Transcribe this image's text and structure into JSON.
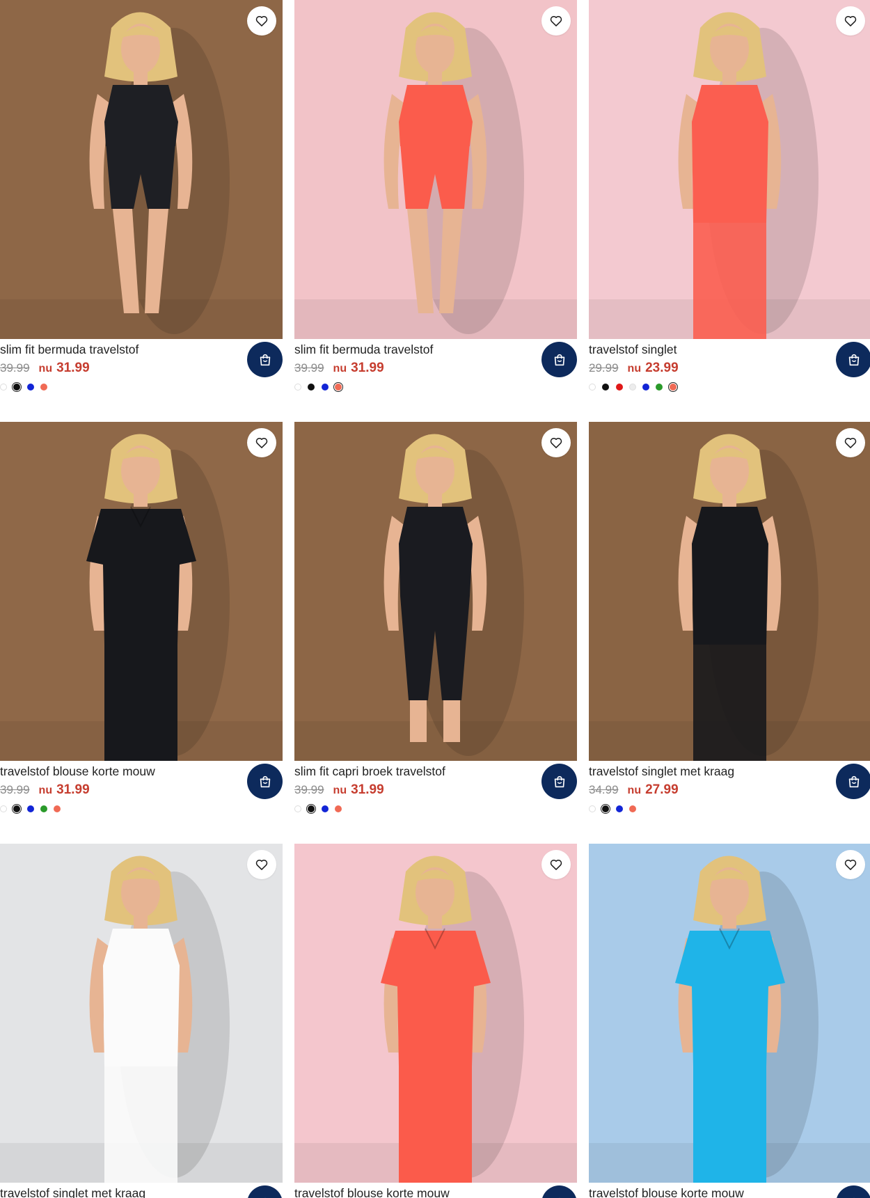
{
  "products": [
    {
      "name": "slim fit bermuda travelstof",
      "old_price": "39.99",
      "nu_label": "nu",
      "new_price": "31.99",
      "photo": {
        "bg": "#8e6747",
        "garment": "#1e1f24",
        "style": "bermuda"
      },
      "swatches": [
        {
          "color": "#ffffff",
          "selected": false
        },
        {
          "color": "#111111",
          "selected": true
        },
        {
          "color": "#1225d6",
          "selected": false
        },
        {
          "color": "#f06a55",
          "selected": false
        }
      ]
    },
    {
      "name": "slim fit bermuda travelstof",
      "old_price": "39.99",
      "nu_label": "nu",
      "new_price": "31.99",
      "photo": {
        "bg": "#f2c3c8",
        "garment": "#fb5c4c",
        "style": "bermuda"
      },
      "swatches": [
        {
          "color": "#ffffff",
          "selected": false
        },
        {
          "color": "#111111",
          "selected": false
        },
        {
          "color": "#1225d6",
          "selected": false
        },
        {
          "color": "#f06a55",
          "selected": true
        }
      ]
    },
    {
      "name": "travelstof singlet",
      "old_price": "29.99",
      "nu_label": "nu",
      "new_price": "23.99",
      "photo": {
        "bg": "#f3c9d0",
        "garment": "#fb5e50",
        "style": "singlet"
      },
      "swatches": [
        {
          "color": "#ffffff",
          "selected": false
        },
        {
          "color": "#111111",
          "selected": false
        },
        {
          "color": "#e01818",
          "selected": false
        },
        {
          "color": "#ececec",
          "selected": false
        },
        {
          "color": "#1225d6",
          "selected": false
        },
        {
          "color": "#2a9a2a",
          "selected": false
        },
        {
          "color": "#f06a55",
          "selected": true
        }
      ]
    },
    {
      "name": "travelstof blouse korte mouw",
      "old_price": "39.99",
      "nu_label": "nu",
      "new_price": "31.99",
      "photo": {
        "bg": "#8f6848",
        "garment": "#17181c",
        "style": "blouse"
      },
      "swatches": [
        {
          "color": "#ffffff",
          "selected": false
        },
        {
          "color": "#111111",
          "selected": true
        },
        {
          "color": "#1225d6",
          "selected": false
        },
        {
          "color": "#2a9a2a",
          "selected": false
        },
        {
          "color": "#f06a55",
          "selected": false
        }
      ]
    },
    {
      "name": "slim fit capri broek travelstof",
      "old_price": "39.99",
      "nu_label": "nu",
      "new_price": "31.99",
      "photo": {
        "bg": "#8d6646",
        "garment": "#1a1b20",
        "style": "capri"
      },
      "swatches": [
        {
          "color": "#ffffff",
          "selected": false
        },
        {
          "color": "#111111",
          "selected": true
        },
        {
          "color": "#1225d6",
          "selected": false
        },
        {
          "color": "#f06a55",
          "selected": false
        }
      ]
    },
    {
      "name": "travelstof singlet met kraag",
      "old_price": "34.99",
      "nu_label": "nu",
      "new_price": "27.99",
      "photo": {
        "bg": "#8a6444",
        "garment": "#17181c",
        "style": "singlet"
      },
      "swatches": [
        {
          "color": "#ffffff",
          "selected": false
        },
        {
          "color": "#111111",
          "selected": true
        },
        {
          "color": "#1225d6",
          "selected": false
        },
        {
          "color": "#f06a55",
          "selected": false
        }
      ]
    },
    {
      "name": "travelstof singlet met kraag",
      "old_price": "",
      "nu_label": "",
      "new_price": "",
      "photo": {
        "bg": "#e3e4e6",
        "garment": "#fbfbfb",
        "style": "singlet"
      },
      "swatches": []
    },
    {
      "name": "travelstof blouse korte mouw",
      "old_price": "",
      "nu_label": "",
      "new_price": "",
      "photo": {
        "bg": "#f4c6cd",
        "garment": "#fb5b4b",
        "style": "blouse"
      },
      "swatches": []
    },
    {
      "name": "travelstof blouse korte mouw",
      "old_price": "",
      "nu_label": "",
      "new_price": "",
      "photo": {
        "bg": "#a9cbe9",
        "garment": "#1fb4e8",
        "style": "blouse"
      },
      "swatches": []
    }
  ],
  "icons": {
    "wishlist": "heart-icon",
    "cart": "shopping-bag-icon"
  },
  "colors": {
    "cart_button": "#0d2a5c",
    "sale_price": "#c63d2f",
    "old_price": "#8a8a8a"
  }
}
